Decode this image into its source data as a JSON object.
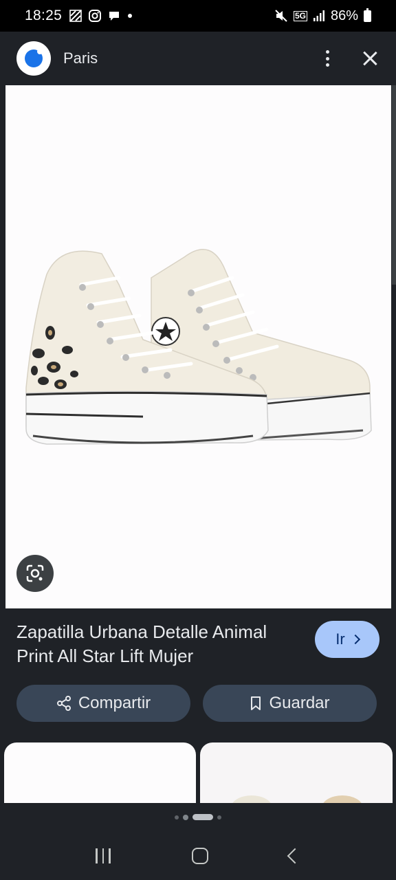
{
  "status_bar": {
    "time": "18:25",
    "network": "5G",
    "battery": "86%",
    "icons": [
      "screenshot-icon",
      "instagram-icon",
      "chat-icon",
      "dot-icon",
      "mute-icon",
      "signal-icon",
      "battery-icon"
    ]
  },
  "header": {
    "title": "Paris",
    "logo": "google-app-logo",
    "more_icon": "more-vert-icon",
    "close_icon": "close-icon"
  },
  "product": {
    "image_alt_icon": "google-lens-icon",
    "title": "Zapatilla Urbana Detalle Animal Print All Star Lift Mujer",
    "go_button": "Ir"
  },
  "actions": {
    "share_label": "Compartir",
    "save_label": "Guardar"
  },
  "pager": {
    "pages": 4,
    "active_index": 2
  },
  "colors": {
    "background": "#1f2227",
    "accent_button": "#a8c7fa",
    "secondary_button": "#394657",
    "text": "#e8eaed"
  }
}
